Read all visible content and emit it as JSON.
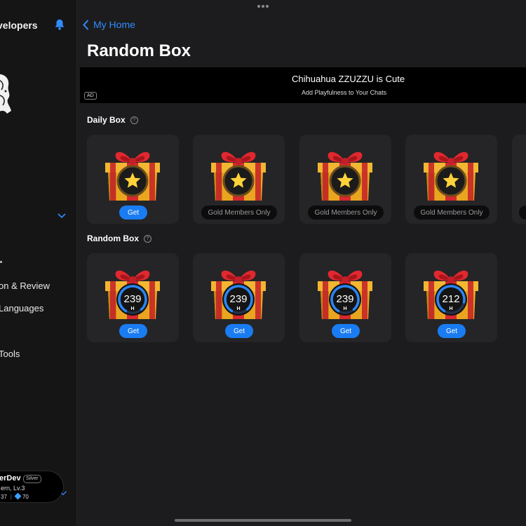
{
  "sidebar": {
    "title": "velopers",
    "items": [
      {
        "label": "on & Review"
      },
      {
        "label": "Languages"
      },
      {
        "label": "Tools"
      }
    ]
  },
  "profile": {
    "name": "erDev",
    "badge": "Silver",
    "level": "ern, Lv.3",
    "stat1": "37",
    "stat2": "70"
  },
  "header": {
    "back_label": "My Home",
    "title": "Random Box"
  },
  "ad": {
    "title": "Chihuahua ZZUZZU is Cute",
    "subtitle": "Add Playfulness to Your Chats",
    "badge": "AD"
  },
  "sections": {
    "daily": {
      "title": "Daily Box",
      "help": "?",
      "cards": [
        {
          "button": "Get",
          "kind": "get",
          "icon": "star"
        },
        {
          "button": "Gold Members Only",
          "kind": "gold",
          "icon": "star"
        },
        {
          "button": "Gold Members Only",
          "kind": "gold",
          "icon": "star"
        },
        {
          "button": "Gold Members Only",
          "kind": "gold",
          "icon": "star"
        }
      ]
    },
    "random": {
      "title": "Random Box",
      "help": "?",
      "cards": [
        {
          "button": "Get",
          "value": "239",
          "unit": "H",
          "progress": 0.8
        },
        {
          "button": "Get",
          "value": "239",
          "unit": "H",
          "progress": 0.8
        },
        {
          "button": "Get",
          "value": "239",
          "unit": "H",
          "progress": 0.8
        },
        {
          "button": "Get",
          "value": "212",
          "unit": "H",
          "progress": 0.7
        }
      ]
    }
  },
  "colors": {
    "accent": "#1a7cf2",
    "link": "#2f8cff",
    "gift_gold": "#e9a520",
    "gift_red": "#d7282f"
  }
}
